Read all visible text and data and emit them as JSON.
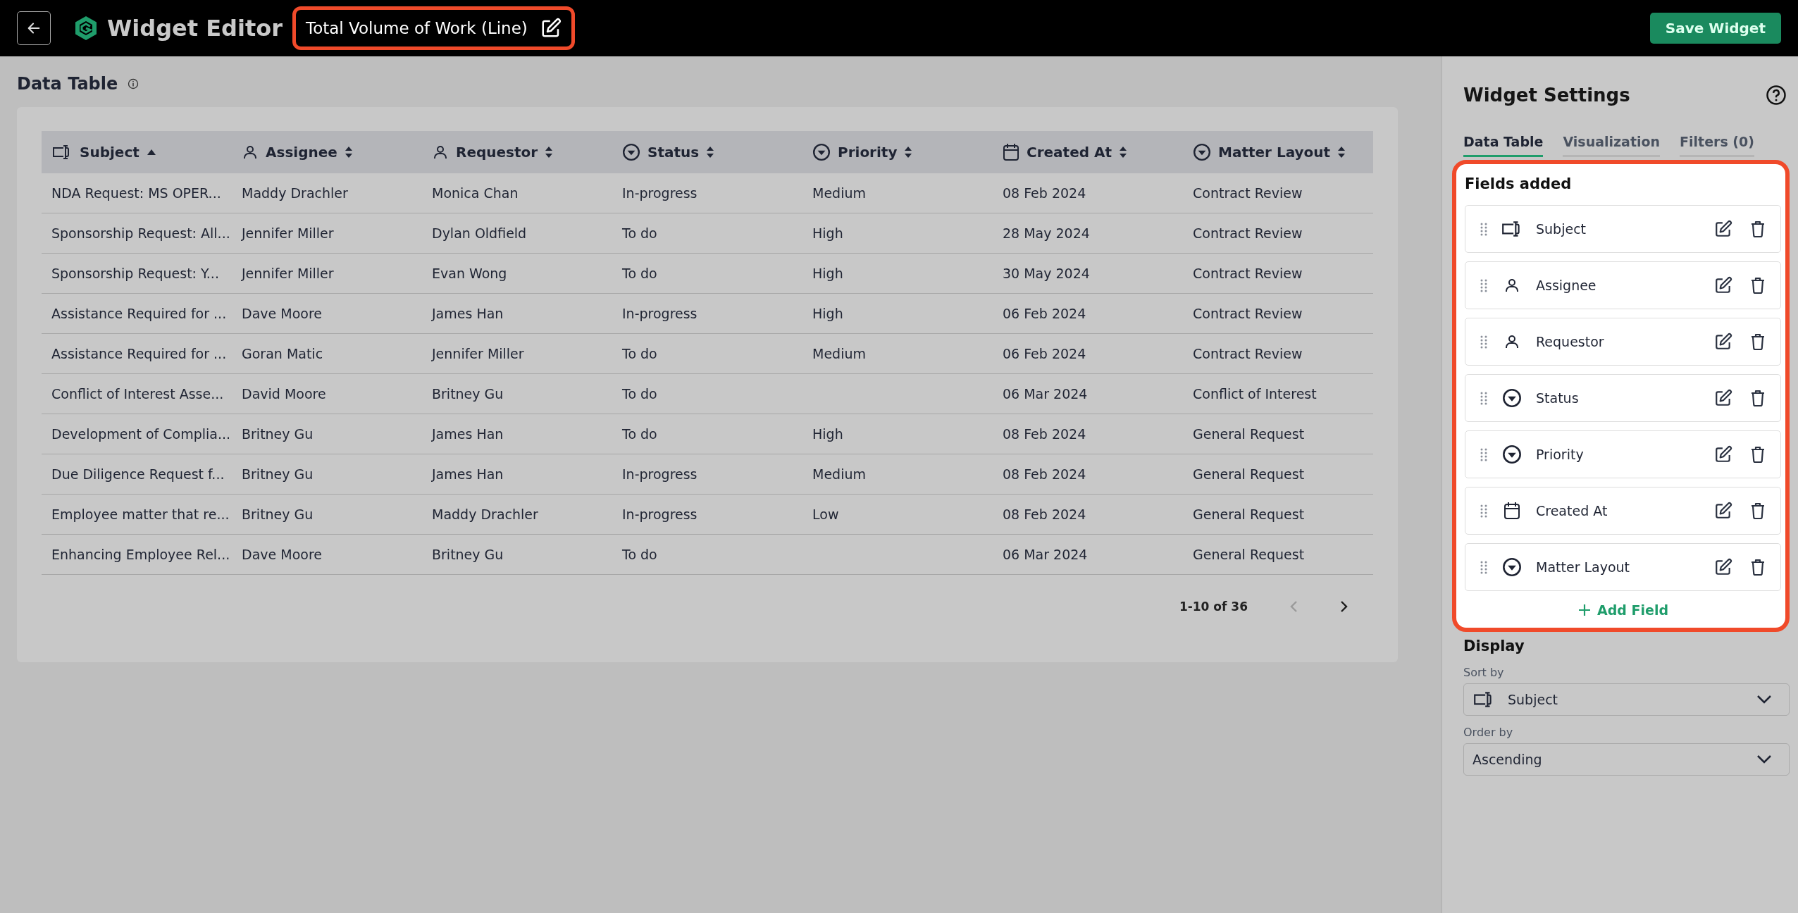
{
  "header": {
    "app_title": "Widget Editor",
    "widget_title": "Total Volume of Work (Line)",
    "save_button": "Save Widget"
  },
  "data_table": {
    "title": "Data Table",
    "columns": [
      {
        "label": "Subject",
        "kind": "text",
        "sorted": true
      },
      {
        "label": "Assignee",
        "kind": "person",
        "sorted": false
      },
      {
        "label": "Requestor",
        "kind": "person",
        "sorted": false
      },
      {
        "label": "Status",
        "kind": "select",
        "sorted": false
      },
      {
        "label": "Priority",
        "kind": "select",
        "sorted": false
      },
      {
        "label": "Created At",
        "kind": "date",
        "sorted": false
      },
      {
        "label": "Matter Layout",
        "kind": "select",
        "sorted": false
      }
    ],
    "rows": [
      [
        "NDA Request: MS OPER...",
        "Maddy Drachler",
        "Monica Chan",
        "In-progress",
        "Medium",
        "08 Feb 2024",
        "Contract Review"
      ],
      [
        "Sponsorship Request: All...",
        "Jennifer Miller",
        "Dylan Oldfield",
        "To do",
        "High",
        "28 May 2024",
        "Contract Review"
      ],
      [
        "Sponsorship Request: Y...",
        "Jennifer Miller",
        "Evan Wong",
        "To do",
        "High",
        "30 May 2024",
        "Contract Review"
      ],
      [
        "Assistance Required for ...",
        "Dave Moore",
        "James Han",
        "In-progress",
        "High",
        "06 Feb 2024",
        "Contract Review"
      ],
      [
        "Assistance Required for ...",
        "Goran Matic",
        "Jennifer Miller",
        "To do",
        "Medium",
        "06 Feb 2024",
        "Contract Review"
      ],
      [
        "Conflict of Interest Asse...",
        "David Moore",
        "Britney Gu",
        "To do",
        null,
        "06 Mar 2024",
        "Conflict of Interest"
      ],
      [
        "Development of Complia...",
        "Britney Gu",
        "James Han",
        "To do",
        "High",
        "08 Feb 2024",
        "General Request"
      ],
      [
        "Due Diligence Request f...",
        "Britney Gu",
        "James Han",
        "In-progress",
        "Medium",
        "08 Feb 2024",
        "General Request"
      ],
      [
        "Employee matter that re...",
        "Britney Gu",
        "Maddy Drachler",
        "In-progress",
        "Low",
        "08 Feb 2024",
        "General Request"
      ],
      [
        "Enhancing Employee Rel...",
        "Dave Moore",
        "Britney Gu",
        "To do",
        null,
        "06 Mar 2024",
        "General Request"
      ]
    ],
    "pagination": {
      "range": "1-10 of 36",
      "prev_disabled": true,
      "next_disabled": false
    }
  },
  "settings": {
    "title": "Widget Settings",
    "tabs": [
      {
        "label": "Data Table",
        "selected": true
      },
      {
        "label": "Visualization",
        "selected": false
      },
      {
        "label": "Filters (0)",
        "selected": false
      }
    ],
    "fields_title": "Fields added",
    "fields": [
      {
        "label": "Subject",
        "kind": "text"
      },
      {
        "label": "Assignee",
        "kind": "person"
      },
      {
        "label": "Requestor",
        "kind": "person"
      },
      {
        "label": "Status",
        "kind": "select"
      },
      {
        "label": "Priority",
        "kind": "select"
      },
      {
        "label": "Created At",
        "kind": "date"
      },
      {
        "label": "Matter Layout",
        "kind": "select"
      }
    ],
    "add_field": "Add Field",
    "display_title": "Display",
    "sort_by": {
      "label": "Sort by",
      "value": "Subject",
      "kind": "text"
    },
    "order_by": {
      "label": "Order by",
      "value": "Ascending"
    }
  }
}
